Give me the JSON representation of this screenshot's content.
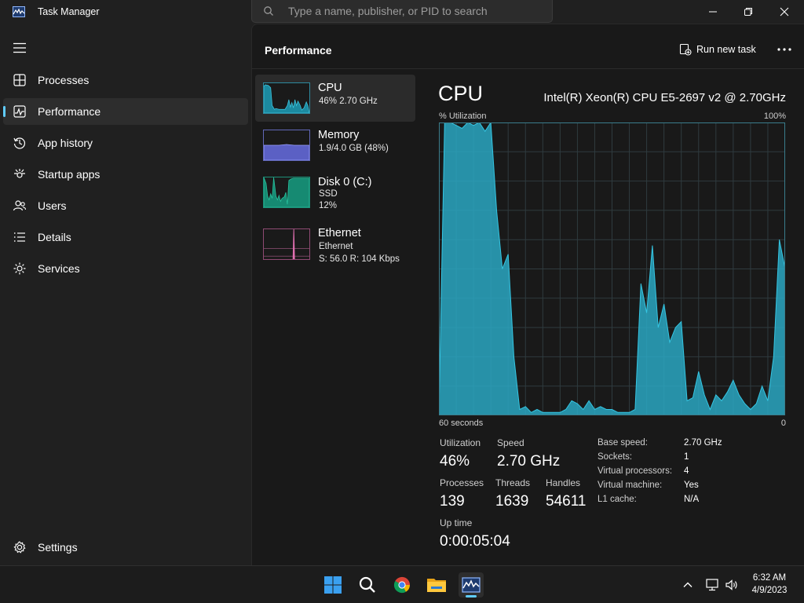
{
  "window": {
    "title": "Task Manager"
  },
  "search": {
    "placeholder": "Type a name, publisher, or PID to search"
  },
  "sidebar": {
    "items": [
      {
        "label": "Processes",
        "icon": "processes-icon"
      },
      {
        "label": "Performance",
        "icon": "performance-icon",
        "active": true
      },
      {
        "label": "App history",
        "icon": "history-icon"
      },
      {
        "label": "Startup apps",
        "icon": "startup-icon"
      },
      {
        "label": "Users",
        "icon": "users-icon"
      },
      {
        "label": "Details",
        "icon": "details-icon"
      },
      {
        "label": "Services",
        "icon": "services-icon"
      }
    ],
    "settings_label": "Settings"
  },
  "header": {
    "title": "Performance",
    "run_new_task": "Run new task"
  },
  "devices": [
    {
      "name": "CPU",
      "line1": "46% 2.70 GHz",
      "line2": "",
      "color": "#17a3b8"
    },
    {
      "name": "Memory",
      "line1": "1.9/4.0 GB (48%)",
      "line2": "",
      "color": "#7b7fd6"
    },
    {
      "name": "Disk 0 (C:)",
      "line1": "SSD",
      "line2": "12%",
      "color": "#1fa88a"
    },
    {
      "name": "Ethernet",
      "line1": "Ethernet",
      "line2": "S: 56.0 R: 104 Kbps",
      "color": "#e06fb0"
    }
  ],
  "detail": {
    "title": "CPU",
    "model": "Intel(R) Xeon(R) CPU E5-2697 v2 @ 2.70GHz",
    "util_label": "% Utilization",
    "util_max": "100%",
    "time_span": "60 seconds",
    "time_zero": "0",
    "stats": {
      "utilization_label": "Utilization",
      "utilization": "46%",
      "speed_label": "Speed",
      "speed": "2.70 GHz",
      "processes_label": "Processes",
      "processes": "139",
      "threads_label": "Threads",
      "threads": "1639",
      "handles_label": "Handles",
      "handles": "54611",
      "uptime_label": "Up time",
      "uptime": "0:00:05:04"
    },
    "specs": [
      {
        "label": "Base speed:",
        "value": "2.70 GHz"
      },
      {
        "label": "Sockets:",
        "value": "1"
      },
      {
        "label": "Virtual processors:",
        "value": "4"
      },
      {
        "label": "Virtual machine:",
        "value": "Yes"
      },
      {
        "label": "L1 cache:",
        "value": "N/A"
      }
    ],
    "colors": {
      "graph_fill": "#2aa7c2",
      "graph_line": "#35c6e3",
      "grid": "#2f3b3f",
      "border": "#3a7d8c"
    }
  },
  "chart_data": {
    "type": "area",
    "x": [
      60,
      59,
      58,
      57,
      56,
      55,
      54,
      53,
      52,
      51,
      50,
      49,
      48,
      47,
      46,
      45,
      44,
      43,
      42,
      41,
      40,
      39,
      38,
      37,
      36,
      35,
      34,
      33,
      32,
      31,
      30,
      29,
      28,
      27,
      26,
      25,
      24,
      23,
      22,
      21,
      20,
      19,
      18,
      17,
      16,
      15,
      14,
      13,
      12,
      11,
      10,
      9,
      8,
      7,
      6,
      5,
      4,
      3,
      2,
      1,
      0
    ],
    "values": [
      0,
      100,
      100,
      99,
      98,
      100,
      99,
      100,
      97,
      100,
      70,
      50,
      55,
      20,
      2,
      3,
      1,
      2,
      1,
      1,
      1,
      1,
      2,
      5,
      4,
      2,
      5,
      2,
      3,
      2,
      2,
      1,
      1,
      1,
      2,
      45,
      35,
      58,
      30,
      38,
      25,
      30,
      32,
      5,
      6,
      15,
      7,
      2,
      7,
      5,
      8,
      12,
      7,
      4,
      2,
      4,
      10,
      5,
      20,
      60,
      50
    ],
    "xlabel": "60 seconds",
    "ylabel": "% Utilization",
    "xlim": [
      60,
      0
    ],
    "ylim": [
      0,
      100
    ],
    "grid": true
  },
  "taskbar": {
    "apps": [
      "start-icon",
      "search-icon",
      "chrome-icon",
      "file-explorer-icon",
      "task-manager-icon"
    ],
    "time": "6:32 AM",
    "date": "4/9/2023"
  }
}
